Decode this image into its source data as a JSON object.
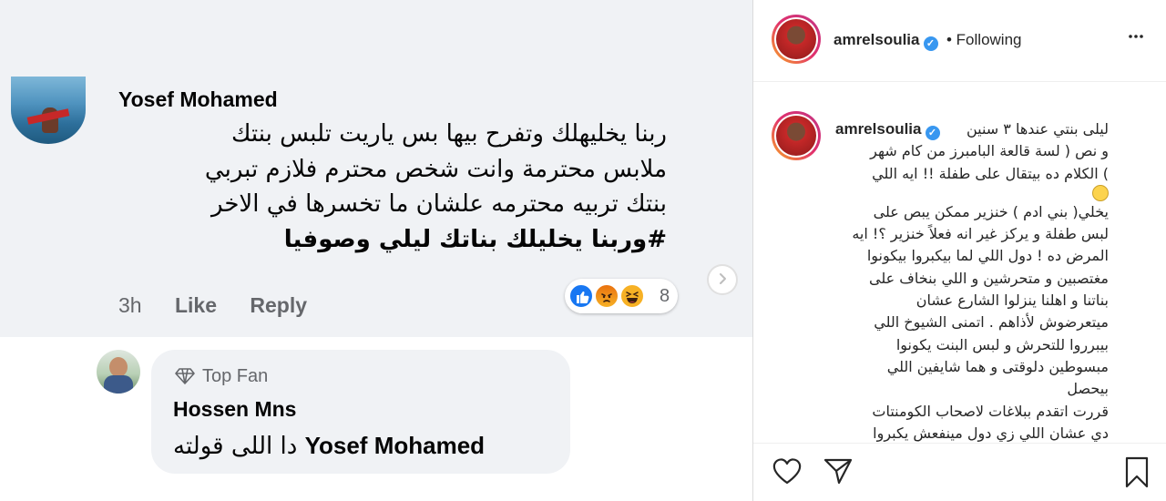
{
  "comment1": {
    "author": "Yosef Mohamed",
    "lines": [
      "ربنا يخليهلك وتفرح بيها  بس ياريت تلبس بنتك",
      "ملابس محترمة  وانت شخص محترم فلازم تبربي",
      "بنتك تربيه محترمه علشان ما تخسرها في الاخر",
      "#وربنا يخليلك  بناتك  ليلي وصوفيا"
    ],
    "time": "3h",
    "like_label": "Like",
    "reply_label": "Reply",
    "reaction_count": "8",
    "reactions": [
      "like-icon",
      "angry-icon",
      "haha-icon"
    ]
  },
  "comment2": {
    "badge": "Top Fan",
    "author": "Hossen Mns",
    "mention": "Yosef Mohamed",
    "text": "دا اللى قولته"
  },
  "post": {
    "username": "amrelsoulia",
    "follow_status": "• Following",
    "caption_lines": [
      "ليلى بنتي عندها ٣ سنين",
      "و نص ( لسة قالعة البامبرز من كام شهر",
      ") الكلام ده بيتقال على طفلة !! ايه اللي",
      "يخلي( بني ادم ) خنزير ممكن يبص على",
      "لبس طفلة و يركز غير انه فعلاً خنزير ؟! ايه",
      "المرض ده ! دول اللي لما بيكبروا بيكونوا",
      "مغتصبين و متحرشين و اللي بنخاف على",
      "بناتنا و اهلنا ينزلوا الشارع عشان",
      "ميتعرضوش لأذاهم . اتمنى الشيوخ اللي",
      "بيبرروا للتحرش و لبس البنت يكونوا",
      "مبسوطين دلوقتى و هما شايفين اللي",
      "بيحصل",
      "قررت اتقدم ببلاغات لاصحاب الكومنتات",
      "دي عشان اللي زي دول مينفعش يكبروا"
    ]
  },
  "colors": {
    "accent_blue": "#3897f0",
    "comment_bg": "#f0f2f5",
    "meta_gray": "#65676b"
  }
}
